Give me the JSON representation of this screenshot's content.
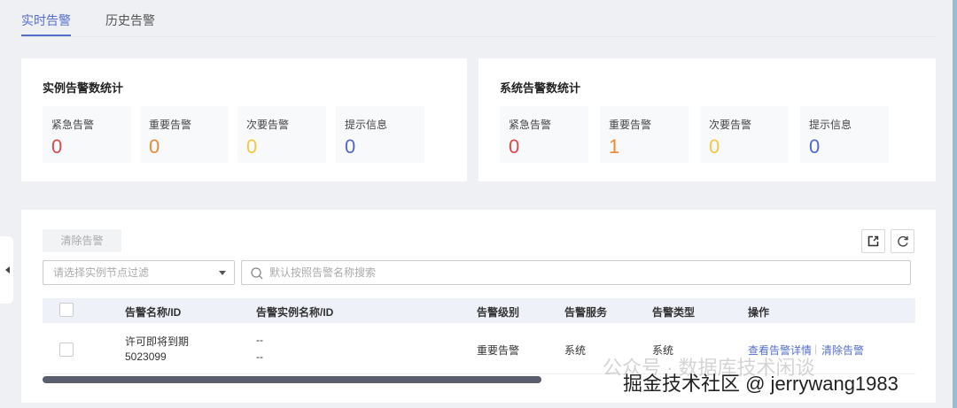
{
  "tabs": [
    {
      "label": "实时告警"
    },
    {
      "label": "历史告警"
    }
  ],
  "instance_stats": {
    "title": "实例告警数统计",
    "items": [
      {
        "label": "紧急告警",
        "value": "0"
      },
      {
        "label": "重要告警",
        "value": "0"
      },
      {
        "label": "次要告警",
        "value": "0"
      },
      {
        "label": "提示信息",
        "value": "0"
      }
    ]
  },
  "system_stats": {
    "title": "系统告警数统计",
    "items": [
      {
        "label": "紧急告警",
        "value": "0"
      },
      {
        "label": "重要告警",
        "value": "1"
      },
      {
        "label": "次要告警",
        "value": "0"
      },
      {
        "label": "提示信息",
        "value": "0"
      }
    ]
  },
  "colors": {
    "critical": "#e04848",
    "major": "#ec8a34",
    "minor": "#f6c744",
    "info": "#5068c8",
    "accent": "#526ecc"
  },
  "toolbar": {
    "clear_label": "清除告警",
    "node_filter_placeholder": "请选择实例节点过滤",
    "search_placeholder": "默认按照告警名称搜索"
  },
  "table": {
    "headers": [
      "告警名称/ID",
      "告警实例名称/ID",
      "告警级别",
      "告警服务",
      "告警类型",
      "操作"
    ],
    "rows": [
      {
        "name": "许可即将到期",
        "id": "5023099",
        "instance_name": "--",
        "instance_id": "--",
        "level": "重要告警",
        "service": "系统",
        "type": "系统",
        "action_view": "查看告警详情",
        "action_clear": "清除告警"
      }
    ]
  },
  "watermark": {
    "line1": "公众号 · 数据库技术闲谈",
    "line2": "掘金技术社区 @ jerrywang1983"
  }
}
